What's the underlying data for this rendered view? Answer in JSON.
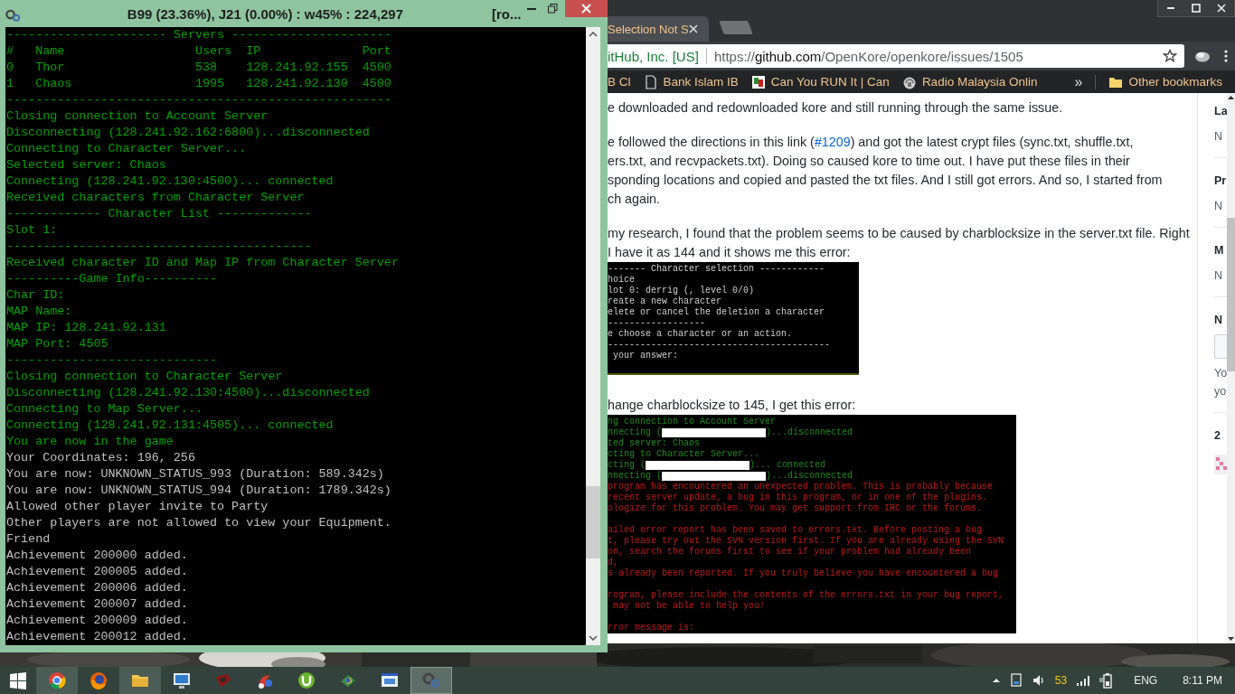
{
  "console_window": {
    "title": "B99 (23.36%), J21 (0.00%) : w45% : 224,297",
    "title_overflow": "[ro...",
    "lines": [
      {
        "text": "---------------------- Servers ----------------------",
        "kind": "status"
      },
      {
        "text": "#   Name                  Users  IP              Port",
        "kind": "status"
      },
      {
        "text": "0   Thor                  538    128.241.92.155  4500",
        "kind": "status"
      },
      {
        "text": "1   Chaos                 1995   128.241.92.130  4500",
        "kind": "status"
      },
      {
        "text": "-----------------------------------------------------",
        "kind": "status"
      },
      {
        "text": "Closing connection to Account Server",
        "kind": "status"
      },
      {
        "text": "Disconnecting (128.241.92.162:6800)...disconnected",
        "kind": "status"
      },
      {
        "text": "Connecting to Character Server...",
        "kind": "status"
      },
      {
        "text": "Selected server: Chaos",
        "kind": "status"
      },
      {
        "text": "Connecting (128.241.92.130:4500)... connected",
        "kind": "status"
      },
      {
        "text": "Received characters from Character Server",
        "kind": "status"
      },
      {
        "text": "------------- Character List -------------",
        "kind": "status"
      },
      {
        "text": "Slot 1:",
        "kind": "status"
      },
      {
        "text": "------------------------------------------",
        "kind": "status"
      },
      {
        "text": "Received character ID and Map IP from Character Server",
        "kind": "status"
      },
      {
        "text": "----------Game Info----------",
        "kind": "status"
      },
      {
        "text": "Char ID:",
        "kind": "status"
      },
      {
        "text": "MAP Name:",
        "kind": "status"
      },
      {
        "text": "MAP IP: 128.241.92.131",
        "kind": "status"
      },
      {
        "text": "MAP Port: 4505",
        "kind": "status"
      },
      {
        "text": "-----------------------------",
        "kind": "status"
      },
      {
        "text": "Closing connection to Character Server",
        "kind": "status"
      },
      {
        "text": "Disconnecting (128.241.92.130:4500)...disconnected",
        "kind": "status"
      },
      {
        "text": "Connecting to Map Server...",
        "kind": "status"
      },
      {
        "text": "Connecting (128.241.92.131:4505)... connected",
        "kind": "status"
      },
      {
        "text": "You are now in the game",
        "kind": "status"
      },
      {
        "text": "Your Coordinates: 196, 256",
        "kind": "output"
      },
      {
        "text": "You are now: UNKNOWN_STATUS_993 (Duration: 589.342s)",
        "kind": "output"
      },
      {
        "text": "You are now: UNKNOWN_STATUS_994 (Duration: 1789.342s)",
        "kind": "output"
      },
      {
        "text": "Allowed other player invite to Party",
        "kind": "output"
      },
      {
        "text": "Other players are not allowed to view your Equipment.",
        "kind": "output"
      },
      {
        "text": "Friend",
        "kind": "output"
      },
      {
        "text": "Achievement 200000 added.",
        "kind": "output"
      },
      {
        "text": "Achievement 200005 added.",
        "kind": "output"
      },
      {
        "text": "Achievement 200006 added.",
        "kind": "output"
      },
      {
        "text": "Achievement 200007 added.",
        "kind": "output"
      },
      {
        "text": "Achievement 200009 added.",
        "kind": "output"
      },
      {
        "text": "Achievement 200012 added.",
        "kind": "output"
      }
    ]
  },
  "browser": {
    "tab": {
      "title": "Selection Not S",
      "selected": true
    },
    "security_label": "itHub, Inc. [US]",
    "url_prefix": "https://",
    "url_host": "github.com",
    "url_path": "/OpenKore/openkore/issues/1505",
    "bookmarks": [
      {
        "label": "B Cl",
        "kind": "none"
      },
      {
        "label": "Bank Islam IB",
        "kind": "page"
      },
      {
        "label": "Can You RUN It | Can",
        "kind": "thumb"
      },
      {
        "label": "Radio Malaysia Onlin",
        "kind": "radio"
      }
    ],
    "overflow": "»",
    "other_bookmarks": "Other bookmarks"
  },
  "issue": {
    "content": [
      {
        "kind": "paragraph",
        "lines": [
          {
            "text": "e downloaded and redownloaded kore and still running through the same issue."
          }
        ]
      },
      {
        "kind": "paragraph",
        "lines": [
          {
            "text": "e followed the directions in this link (",
            "link": "#1209",
            "after": ") and got the latest crypt files (sync.txt, shuffle.txt,"
          },
          {
            "text": "ers.txt, and recvpackets.txt). Doing so caused kore to time out. I have put these files in their"
          },
          {
            "text": "sponding locations and copied and pasted the txt files. And I still got errors. And so, I started from"
          },
          {
            "text": "ch again."
          }
        ]
      },
      {
        "kind": "paragraph",
        "lines": [
          {
            "text": " my research, I found that the problem seems to be caused by charblocksize in the server.txt file. Right"
          },
          {
            "text": " I have it as 144 and it shows me this error:"
          }
        ]
      },
      {
        "kind": "terminal",
        "lines": [
          {
            "kind": "plain",
            "text": "------- Character selection ------------"
          },
          {
            "kind": "plain",
            "text": "hoice"
          },
          {
            "kind": "plain",
            "text": "lot 0: derrig (, level 0/0)"
          },
          {
            "kind": "plain",
            "text": "reate a new character"
          },
          {
            "kind": "plain",
            "text": "elete or cancel the deletion a character"
          },
          {
            "kind": "plain",
            "text": "------------------"
          },
          {
            "kind": "plain",
            "text": "e choose a character or an action."
          },
          {
            "kind": "plain",
            "text": "-----------------------------------------"
          },
          {
            "kind": "plain",
            "text": " your answer:"
          }
        ]
      },
      {
        "kind": "paragraph",
        "lines": [
          {
            "text": "hange charblocksize to 145, I get this error:"
          }
        ]
      },
      {
        "kind": "terminal",
        "lines": [
          {
            "kind": "log",
            "text": "ng connection to Account Server"
          },
          {
            "kind": "redacted",
            "text": "nnecting (",
            "after": ")...disconnected"
          },
          {
            "kind": "log",
            "text": "ted server: Chaos"
          },
          {
            "kind": "log",
            "text": "cting to Character Server..."
          },
          {
            "kind": "redacted",
            "text": "cting (",
            "after": ")... connected"
          },
          {
            "kind": "redacted",
            "text": "nnecting (",
            "after": ")...disconnected"
          },
          {
            "kind": "error",
            "text": "program has encountered an unexpected problem. This is probably because"
          },
          {
            "kind": "error",
            "text": "recent server update, a bug in this program, or in one of the plugins."
          },
          {
            "kind": "error",
            "text": "ologize for this problem. You may get support from IRC or the forums."
          },
          {
            "kind": "blank"
          },
          {
            "kind": "error",
            "text": "ailed error report has been saved to errors.txt. Before posting a bug"
          },
          {
            "kind": "error",
            "text": "t, please try out the SVN version first. If you are already using the SVN"
          },
          {
            "kind": "error",
            "text": "on, search the forums first to see if your problem had already been"
          },
          {
            "kind": "error",
            "text": "d,"
          },
          {
            "kind": "error",
            "text": "s already been reported. If you truly believe you have encountered a bug"
          },
          {
            "kind": "blank"
          },
          {
            "kind": "error",
            "text": "rogram, please include the contents of the errors.txt in your bug report,"
          },
          {
            "kind": "error",
            "text": " may not be able to help you!"
          },
          {
            "kind": "blank"
          },
          {
            "kind": "error",
            "text": "rror message is:"
          }
        ]
      }
    ]
  },
  "sidebar": {
    "sections": [
      {
        "heading": "La",
        "value": "N"
      },
      {
        "heading": "Pr",
        "value": "N"
      },
      {
        "heading": "M",
        "value": "N"
      }
    ],
    "notifications": {
      "heading": "N",
      "note_lines": [
        "Yo",
        "yo"
      ]
    },
    "participants": {
      "count": "2"
    }
  },
  "taskbar": {
    "apps": [
      {
        "kind": "start",
        "running": false,
        "selected": false
      },
      {
        "kind": "chrome",
        "running": true,
        "selected": false
      },
      {
        "kind": "firefox",
        "running": false,
        "selected": false
      },
      {
        "kind": "folder",
        "running": true,
        "selected": false
      },
      {
        "kind": "monitor",
        "running": false,
        "selected": false
      },
      {
        "kind": "game",
        "running": false,
        "selected": false
      },
      {
        "kind": "paint",
        "running": false,
        "selected": false
      },
      {
        "kind": "torrent",
        "running": false,
        "selected": false
      },
      {
        "kind": "globe",
        "running": false,
        "selected": false
      },
      {
        "kind": "screen",
        "running": false,
        "selected": false
      },
      {
        "kind": "console",
        "running": true,
        "selected": true
      }
    ],
    "tray": {
      "count": "53",
      "language": "ENG",
      "time": "8:11 PM"
    }
  }
}
